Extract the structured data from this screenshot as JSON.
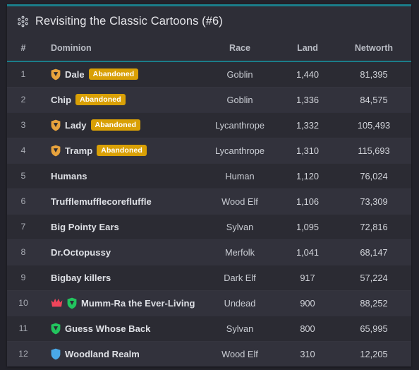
{
  "card": {
    "title": "Revisiting the Classic Cartoons (#6)",
    "title_icon": "sitemap-icon",
    "accent_color": "#1b7d8a",
    "background": "#2b2b33",
    "header_background": "#2e2e37"
  },
  "table": {
    "columns": [
      {
        "key": "num",
        "label": "#"
      },
      {
        "key": "dom",
        "label": "Dominion"
      },
      {
        "key": "race",
        "label": "Race"
      },
      {
        "key": "land",
        "label": "Land"
      },
      {
        "key": "nw",
        "label": "Networth"
      }
    ],
    "badge_label": "Abandoned",
    "badge_color": "#d9a006",
    "icon_colors": {
      "shield-orange": "#e8a33d",
      "shield-green": "#22c55e",
      "shield-blue": "#4aa9e8",
      "crown-red": "#f0455b"
    },
    "rows": [
      {
        "num": "1",
        "name": "Dale",
        "icons": [
          "shield-orange"
        ],
        "badge": "Abandoned",
        "race": "Goblin",
        "land": "1,440",
        "nw": "81,395"
      },
      {
        "num": "2",
        "name": "Chip",
        "icons": [],
        "badge": "Abandoned",
        "race": "Goblin",
        "land": "1,336",
        "nw": "84,575"
      },
      {
        "num": "3",
        "name": "Lady",
        "icons": [
          "shield-orange"
        ],
        "badge": "Abandoned",
        "race": "Lycanthrope",
        "land": "1,332",
        "nw": "105,493"
      },
      {
        "num": "4",
        "name": "Tramp",
        "icons": [
          "shield-orange"
        ],
        "badge": "Abandoned",
        "race": "Lycanthrope",
        "land": "1,310",
        "nw": "115,693"
      },
      {
        "num": "5",
        "name": "Humans",
        "icons": [],
        "badge": "",
        "race": "Human",
        "land": "1,120",
        "nw": "76,024"
      },
      {
        "num": "6",
        "name": "Trufflemufflecorefluffle",
        "icons": [],
        "badge": "",
        "race": "Wood Elf",
        "land": "1,106",
        "nw": "73,309"
      },
      {
        "num": "7",
        "name": "Big Pointy Ears",
        "icons": [],
        "badge": "",
        "race": "Sylvan",
        "land": "1,095",
        "nw": "72,816"
      },
      {
        "num": "8",
        "name": "Dr.Octopussy",
        "icons": [],
        "badge": "",
        "race": "Merfolk",
        "land": "1,041",
        "nw": "68,147"
      },
      {
        "num": "9",
        "name": "Bigbay killers",
        "icons": [],
        "badge": "",
        "race": "Dark Elf",
        "land": "917",
        "nw": "57,224"
      },
      {
        "num": "10",
        "name": "Mumm-Ra the Ever-Living",
        "icons": [
          "crown-red",
          "shield-green"
        ],
        "badge": "",
        "race": "Undead",
        "land": "900",
        "nw": "88,252"
      },
      {
        "num": "11",
        "name": "Guess Whose Back",
        "icons": [
          "shield-green"
        ],
        "badge": "",
        "race": "Sylvan",
        "land": "800",
        "nw": "65,995"
      },
      {
        "num": "12",
        "name": "Woodland Realm",
        "icons": [
          "shield-blue"
        ],
        "badge": "",
        "race": "Wood Elf",
        "land": "310",
        "nw": "12,205"
      }
    ]
  }
}
